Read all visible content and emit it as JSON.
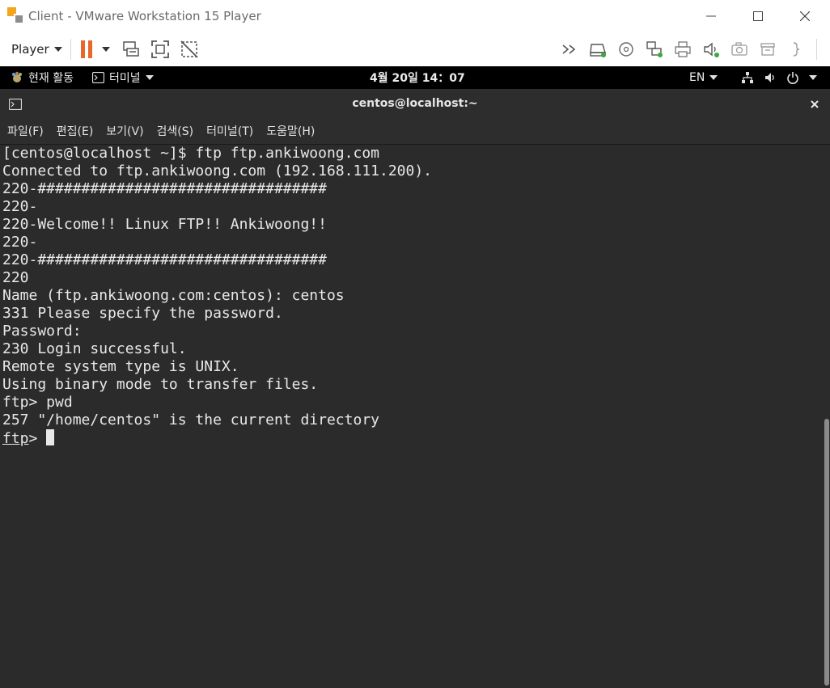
{
  "window": {
    "title": "Client - VMware Workstation 15 Player"
  },
  "toolbar": {
    "player_label": "Player"
  },
  "gnome": {
    "activities": "현재 활동",
    "app_menu": "터미널",
    "clock": "4월 20일  14：07",
    "lang": "EN"
  },
  "terminal": {
    "title": "centos@localhost:~",
    "menu": [
      "파일(F)",
      "편집(E)",
      "보기(V)",
      "검색(S)",
      "터미널(T)",
      "도움말(H)"
    ],
    "lines": [
      "[centos@localhost ~]$ ftp ftp.ankiwoong.com",
      "Connected to ftp.ankiwoong.com (192.168.111.200).",
      "220-#################################",
      "220-",
      "220-Welcome!! Linux FTP!! Ankiwoong!!",
      "220-",
      "220-#################################",
      "220",
      "Name (ftp.ankiwoong.com:centos): centos",
      "331 Please specify the password.",
      "Password:",
      "230 Login successful.",
      "Remote system type is UNIX.",
      "Using binary mode to transfer files.",
      "ftp> pwd",
      "257 \"/home/centos\" is the current directory"
    ],
    "prompt": "ftp",
    "prompt_suffix": "> "
  },
  "icons": {
    "app": "vmware-icon",
    "pause": "pause-icon",
    "send_keys": "send-ctrl-alt-del-icon",
    "fullscreen": "fullscreen-icon",
    "unity": "unity-icon"
  }
}
